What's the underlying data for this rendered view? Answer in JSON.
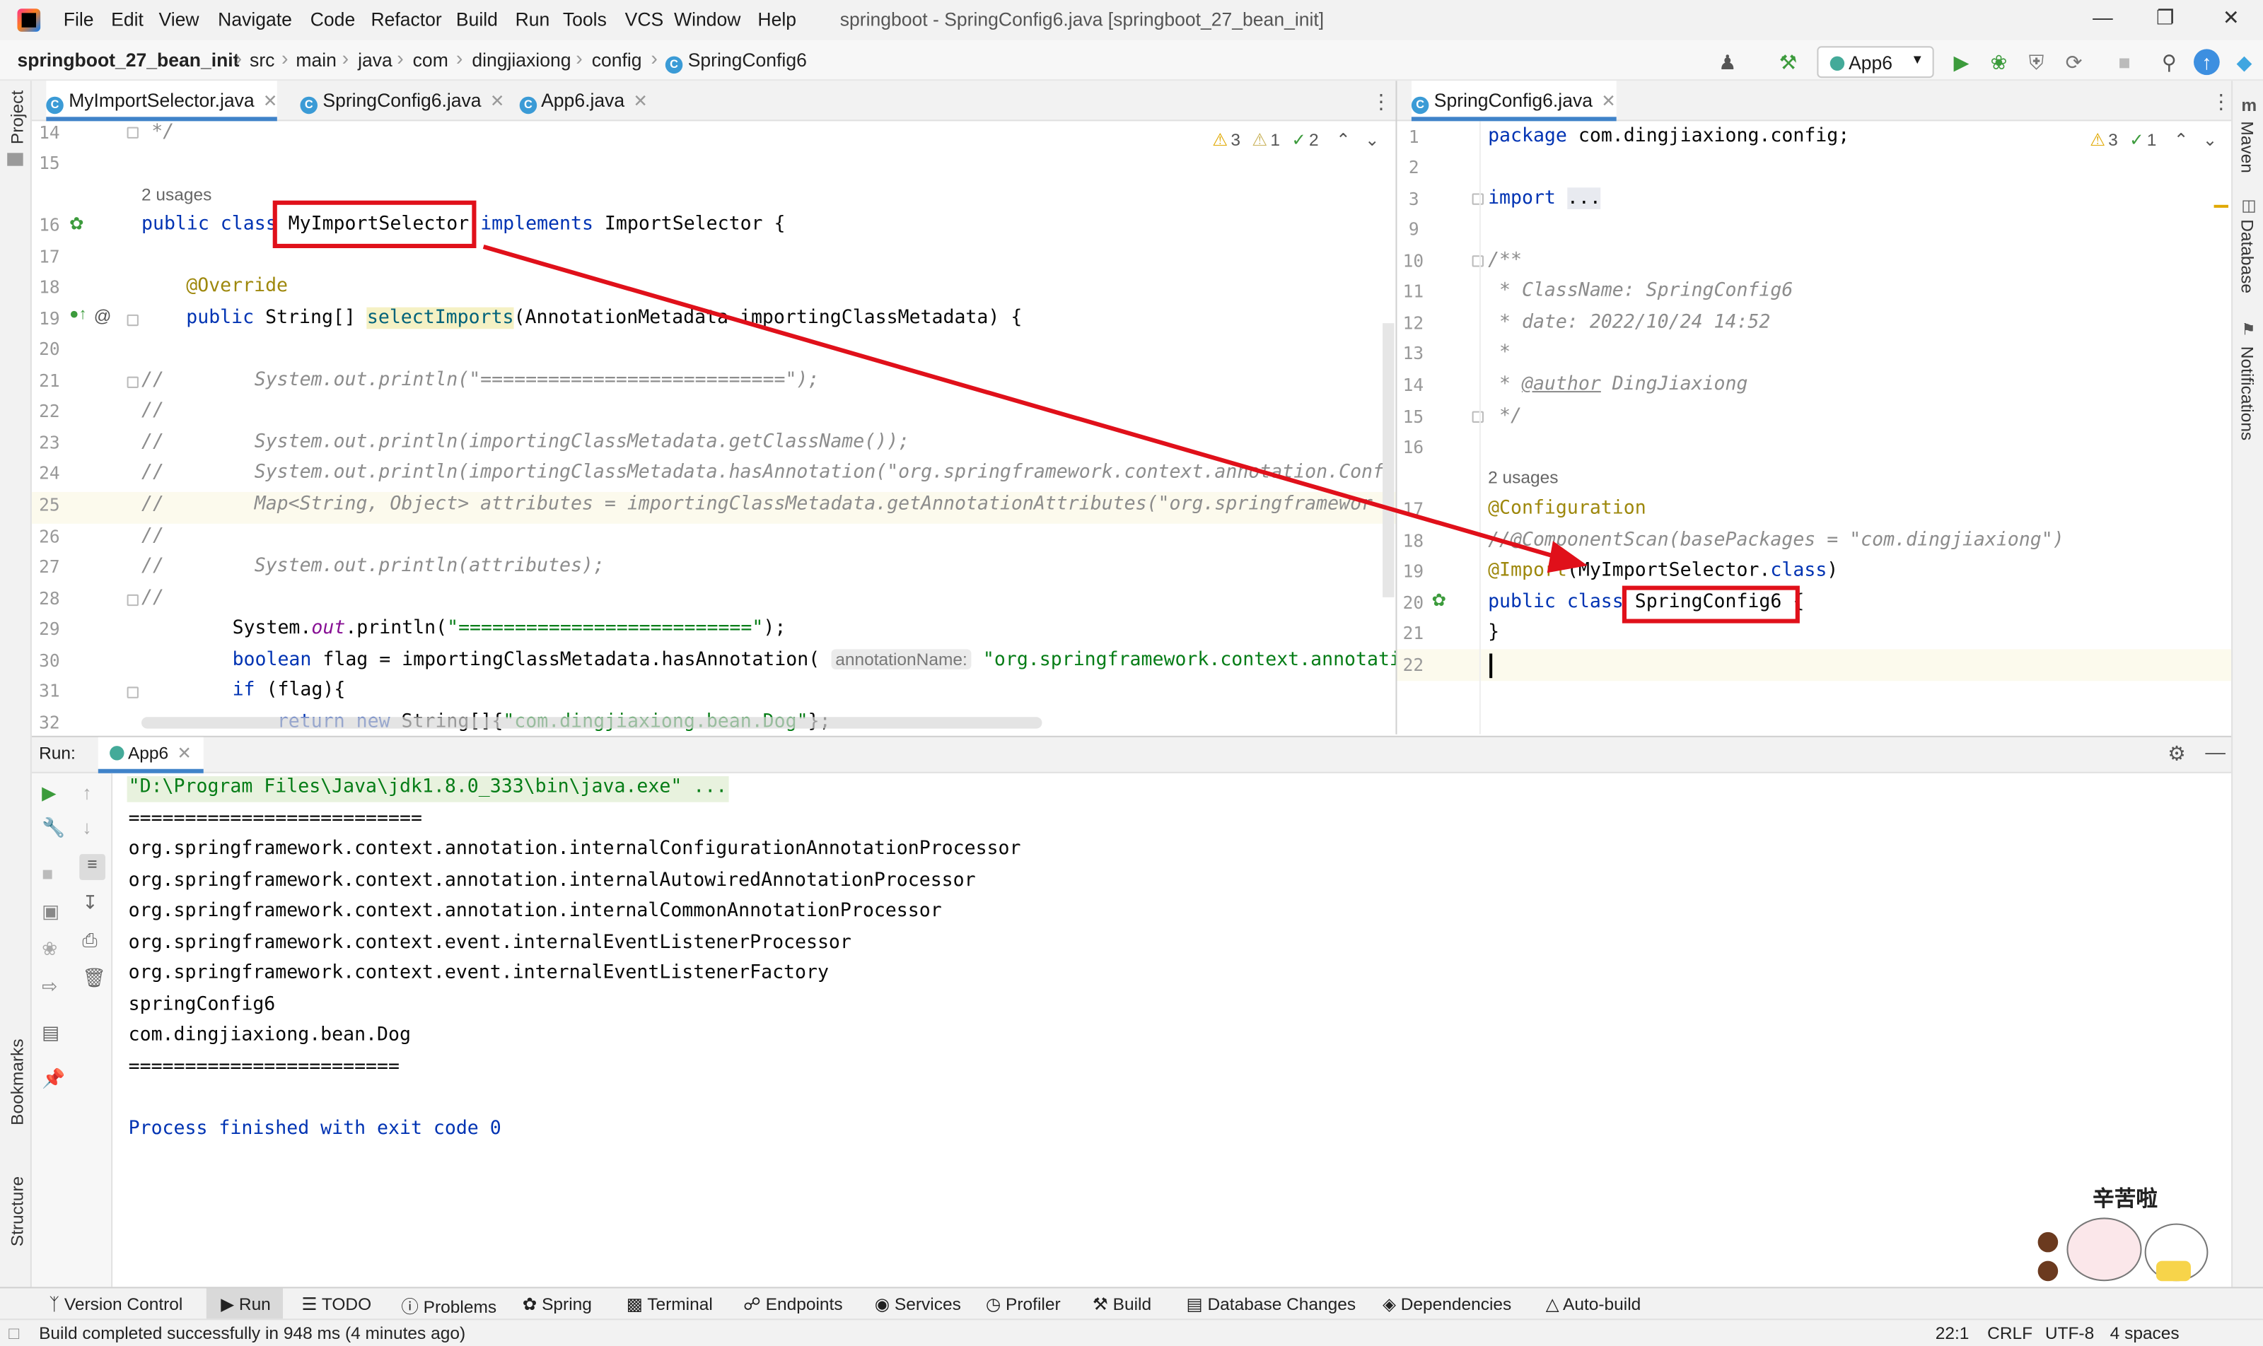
{
  "menu": {
    "items": [
      "File",
      "Edit",
      "View",
      "Navigate",
      "Code",
      "Refactor",
      "Build",
      "Run",
      "Tools",
      "VCS",
      "Window",
      "Help"
    ],
    "title": "springboot - SpringConfig6.java [springboot_27_bean_init]"
  },
  "breadcrumb": [
    "springboot_27_bean_init",
    "src",
    "main",
    "java",
    "com",
    "dingjiaxiong",
    "config",
    "SpringConfig6"
  ],
  "toolbar": {
    "run_config": "App6"
  },
  "left_tabs": [
    {
      "label": "MyImportSelector.java",
      "active": true
    },
    {
      "label": "SpringConfig6.java",
      "active": false
    },
    {
      "label": "App6.java",
      "active": false
    }
  ],
  "right_tabs": [
    {
      "label": "SpringConfig6.java",
      "active": true
    }
  ],
  "left_editor": {
    "inspections": {
      "warnings": "3",
      "weak_warnings": "1",
      "ok": "2"
    },
    "usages": "2 usages",
    "line_numbers": [
      "14",
      "15",
      "16",
      "17",
      "18",
      "19",
      "20",
      "21",
      "22",
      "23",
      "24",
      "25",
      "26",
      "27",
      "28",
      "29",
      "30",
      "31",
      "32"
    ],
    "lines": {
      "l14": "*/",
      "l16_kw": "public class ",
      "l16_name": "MyImportSelector",
      "l16_impl": " implements ",
      "l16_rest": "ImportSelector {",
      "l18": "@Override",
      "l19_kw": "public ",
      "l19_type": "String[] ",
      "l19_fn": "selectImports",
      "l19_rest": "(AnnotationMetadata importingClassMetadata) {",
      "l21": "//        System.out.println(\"===========================\");",
      "l22": "//",
      "l23": "//        System.out.println(importingClassMetadata.getClassName());",
      "l24": "//        System.out.println(importingClassMetadata.hasAnnotation(\"org.springframework.context.annotation.Confi",
      "l25": "//        Map<String, Object> attributes = importingClassMetadata.getAnnotationAttributes(\"org.springframewor",
      "l26": "//",
      "l27": "//        System.out.println(attributes);",
      "l28": "//",
      "l29_a": "System.",
      "l29_b": "out",
      "l29_c": ".println(",
      "l29_str": "\"==========================\"",
      "l29_d": ");",
      "l30_kw": "boolean ",
      "l30_rest": "flag = importingClassMetadata.hasAnnotation(",
      "l30_hint": "annotationName:",
      "l30_str": "\"org.springframework.context.annotati",
      "l31_kw": "if ",
      "l31_rest": "(flag){",
      "l32_kw": "return new ",
      "l32_rest": "String[]{",
      "l32_str": "\"com.dingjiaxiong.bean.Dog\"",
      "l32_end": "};"
    }
  },
  "right_editor": {
    "inspections": {
      "warnings": "3",
      "ok": "1"
    },
    "usages": "2 usages",
    "line_numbers": [
      "1",
      "2",
      "3",
      "9",
      "10",
      "11",
      "12",
      "13",
      "14",
      "15",
      "16",
      "17",
      "18",
      "19",
      "20",
      "21",
      "22"
    ],
    "lines": {
      "l1_kw": "package ",
      "l1_rest": "com.dingjiaxiong.config;",
      "l3_kw": "import ",
      "l3_rest": "...",
      "l10": "/**",
      "l11": " * ClassName: SpringConfig6",
      "l12": " * date: 2022/10/24 14:52",
      "l13": " *",
      "l14_a": " * ",
      "l14_tag": "@author",
      "l14_b": " DingJiaxiong",
      "l15": " */",
      "l17": "@Configuration",
      "l18": "//@ComponentScan(basePackages = \"com.dingjiaxiong\")",
      "l19_ann": "@Import",
      "l19_a": "(MyImportSelector.",
      "l19_kw": "class",
      "l19_b": ")",
      "l20_kw": "public class ",
      "l20_name": "SpringConfig6",
      "l20_rest": " {",
      "l21": "}"
    }
  },
  "run": {
    "label": "Run:",
    "tab": "App6",
    "output": [
      "\"D:\\Program Files\\Java\\jdk1.8.0_333\\bin\\java.exe\" ...",
      "==========================",
      "org.springframework.context.annotation.internalConfigurationAnnotationProcessor",
      "org.springframework.context.annotation.internalAutowiredAnnotationProcessor",
      "org.springframework.context.annotation.internalCommonAnnotationProcessor",
      "org.springframework.context.event.internalEventListenerProcessor",
      "org.springframework.context.event.internalEventListenerFactory",
      "springConfig6",
      "com.dingjiaxiong.bean.Dog",
      "========================",
      "",
      "Process finished with exit code 0"
    ]
  },
  "side_labels": {
    "project": "Project",
    "bookmarks": "Bookmarks",
    "structure": "Structure",
    "maven": "Maven",
    "database": "Database",
    "notifications": "Notifications"
  },
  "tool_windows": [
    "Version Control",
    "Run",
    "TODO",
    "Problems",
    "Spring",
    "Terminal",
    "Endpoints",
    "Services",
    "Profiler",
    "Build",
    "Database Changes",
    "Dependencies",
    "Auto-build"
  ],
  "status": {
    "message": "Build completed successfully in 948 ms (4 minutes ago)",
    "position": "22:1",
    "line_sep": "CRLF",
    "encoding": "UTF-8",
    "indent": "4 spaces"
  },
  "sticker": {
    "text": "辛苦啦"
  },
  "colors": {
    "highlight_box": "#e0101a",
    "arrow": "#e0101a",
    "keyword": "#0033b3",
    "string": "#067d17",
    "annotation": "#9e880d"
  }
}
